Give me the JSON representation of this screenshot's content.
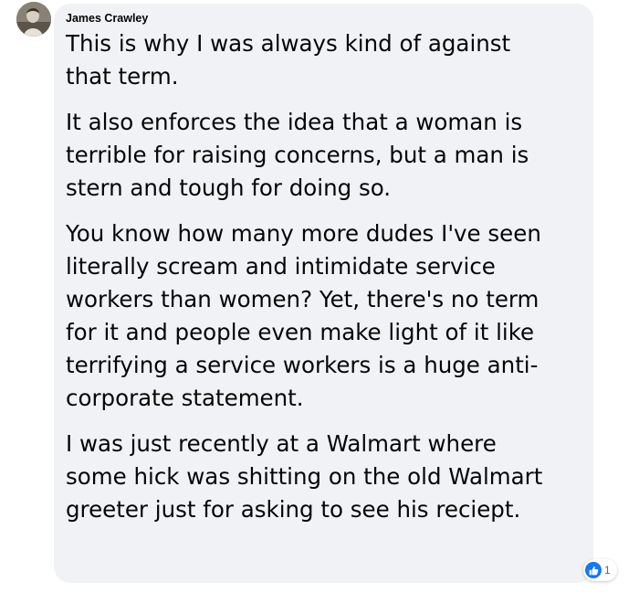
{
  "comment": {
    "author": "James Crawley",
    "paragraphs": [
      "This is why I was always kind of against\nthat term.",
      "It also enforces the idea that a woman is\nterrible for raising concerns, but a man is\nstern and tough for doing so.",
      "You know how many more dudes I've seen\nliterally scream and intimidate service\nworkers than women? Yet, there's no term\nfor it and people even make light of it like\nterrifying a service workers is a huge anti-\ncorporate statement.",
      "I was just recently at a Walmart where\nsome hick was shitting on the old Walmart\ngreeter just for asking to see his reciept."
    ],
    "reaction": {
      "icon": "like-icon",
      "count": "1"
    }
  },
  "colors": {
    "bubble": "#f0f2f5",
    "text": "#050505",
    "like": "#1877f2",
    "count": "#65676b"
  }
}
